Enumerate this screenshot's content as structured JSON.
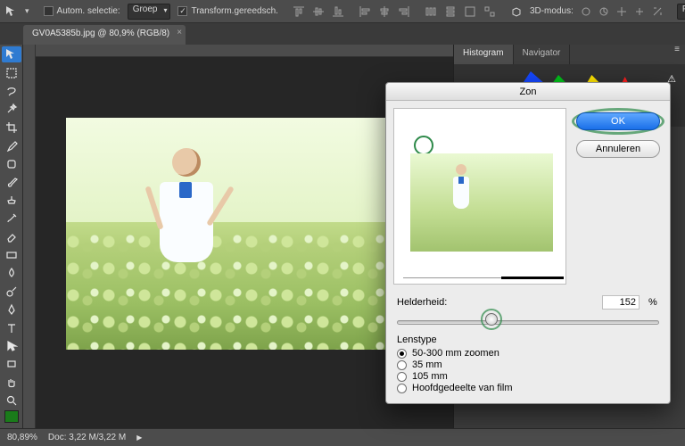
{
  "options_bar": {
    "auto_select_label": "Autom. selectie:",
    "auto_select_checked": false,
    "layer_select_value": "Groep",
    "transform_label": "Transform.gereedsch.",
    "transform_checked": true,
    "mode3d_label": "3D-modus:",
    "preset_value": "Fotografie"
  },
  "document_tab": {
    "title": "GV0A5385b.jpg @ 80,9% (RGB/8)"
  },
  "tools": [
    "move",
    "marquee",
    "lasso",
    "magic-wand",
    "crop",
    "eyedropper",
    "healing-brush",
    "brush",
    "clone-stamp",
    "history-brush",
    "eraser",
    "gradient",
    "blur",
    "dodge",
    "pen",
    "type",
    "path-select",
    "rectangle",
    "hand",
    "zoom"
  ],
  "swatch_fg": "#1a7b1a",
  "panels": {
    "tabs": [
      "Histogram",
      "Navigator"
    ],
    "active_index": 0
  },
  "status_bar": {
    "zoom": "80,89%",
    "doc_info": "Doc: 3,22 M/3,22 M"
  },
  "dialog": {
    "title": "Zon",
    "buttons": {
      "ok": "OK",
      "cancel": "Annuleren"
    },
    "brightness": {
      "label": "Helderheid:",
      "value": "152",
      "unit": "%",
      "position_pct": 36
    },
    "lenstype": {
      "legend": "Lenstype",
      "options": [
        {
          "label": "50-300 mm zoomen",
          "checked": true
        },
        {
          "label": "35 mm",
          "checked": false
        },
        {
          "label": "105 mm",
          "checked": false
        },
        {
          "label": "Hoofdgedeelte van film",
          "checked": false
        }
      ]
    }
  }
}
